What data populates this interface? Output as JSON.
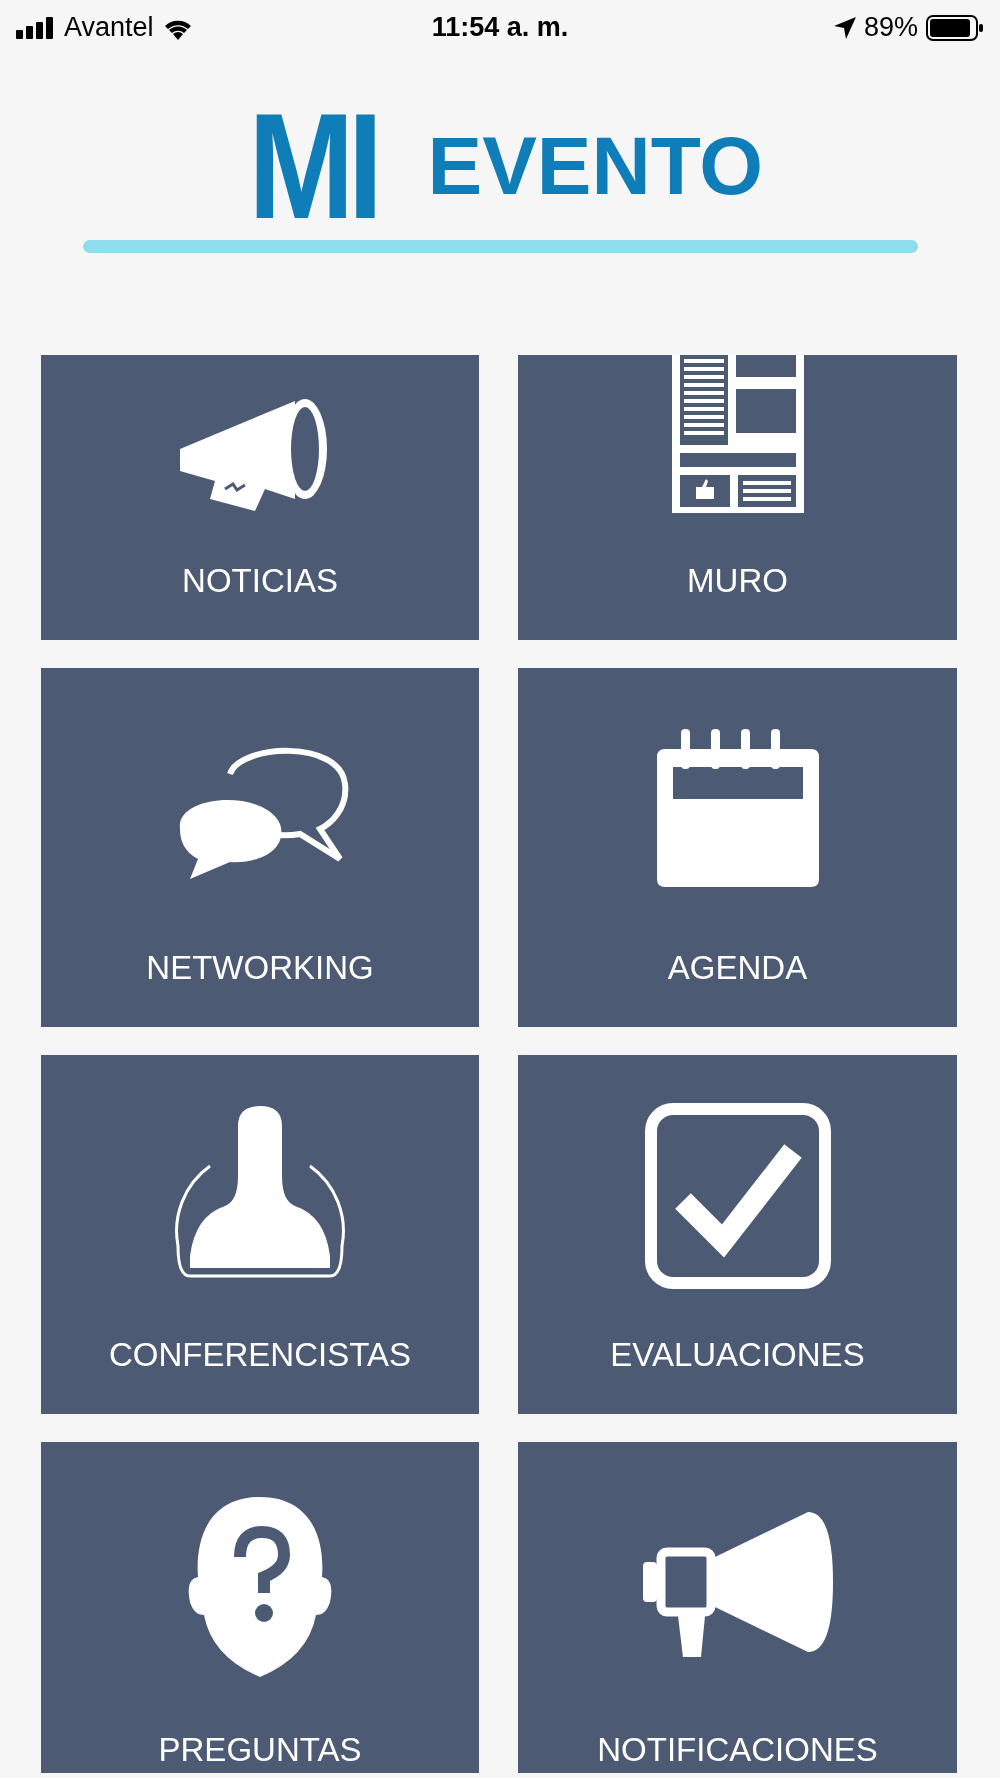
{
  "status_bar": {
    "carrier": "Avantel",
    "time": "11:54 a. m.",
    "battery": "89%"
  },
  "logo": {
    "part_1": "MI",
    "part_2": "EVENTO"
  },
  "tiles": [
    {
      "label": "NOTICIAS",
      "kind": "megaphone"
    },
    {
      "label": "MURO",
      "kind": "newspaper"
    },
    {
      "label": "NETWORKING",
      "kind": "chat"
    },
    {
      "label": "AGENDA",
      "kind": "calendar"
    },
    {
      "label": "CONFERENCISTAS",
      "kind": "person"
    },
    {
      "label": "EVALUACIONES",
      "kind": "check"
    },
    {
      "label": "PREGUNTAS",
      "kind": "question"
    },
    {
      "label": "NOTIFICACIONES",
      "kind": "speaker"
    }
  ]
}
